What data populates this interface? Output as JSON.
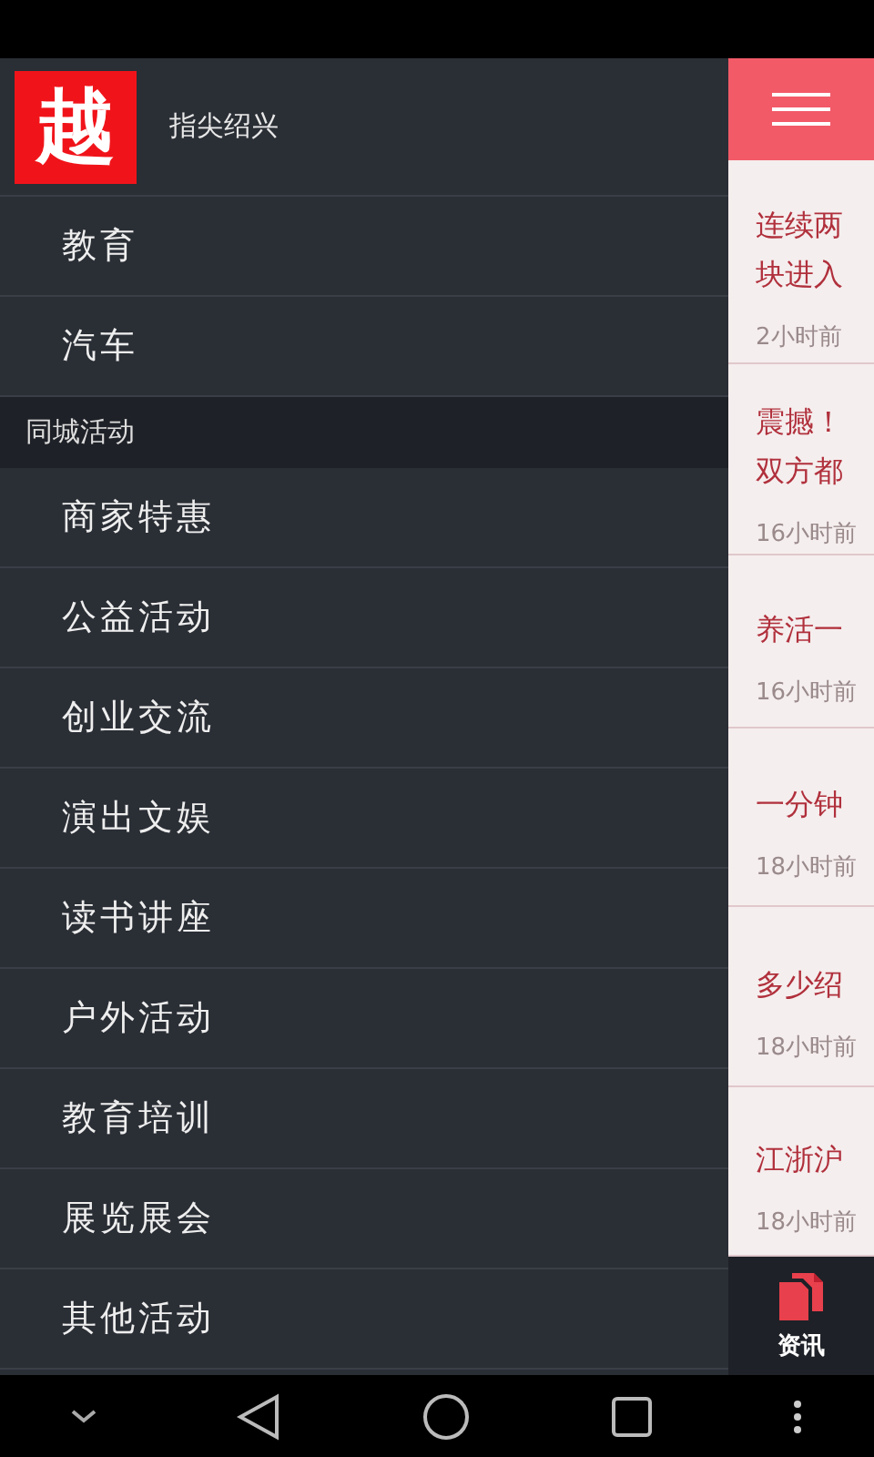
{
  "drawer": {
    "logo": "越",
    "title": "指尖绍兴",
    "items": [
      {
        "label": "教育"
      },
      {
        "label": "汽车"
      }
    ],
    "section": {
      "title": "同城活动",
      "items": [
        {
          "label": "商家特惠"
        },
        {
          "label": "公益活动"
        },
        {
          "label": "创业交流"
        },
        {
          "label": "演出文娱"
        },
        {
          "label": "读书讲座"
        },
        {
          "label": "户外活动"
        },
        {
          "label": "教育培训"
        },
        {
          "label": "展览展会"
        },
        {
          "label": "其他活动"
        }
      ]
    }
  },
  "articles": [
    {
      "title_lines": [
        "连续两",
        "块进入"
      ],
      "time": "2小时前"
    },
    {
      "title_lines": [
        "震撼！",
        "双方都"
      ],
      "time": "16小时前"
    },
    {
      "title_lines": [
        "养活一"
      ],
      "time": "16小时前"
    },
    {
      "title_lines": [
        "一分钟"
      ],
      "time": "18小时前"
    },
    {
      "title_lines": [
        "多少绍"
      ],
      "time": "18小时前"
    },
    {
      "title_lines": [
        "江浙沪"
      ],
      "time": "18小时前"
    }
  ],
  "bottom_tab": {
    "label": "资讯"
  }
}
